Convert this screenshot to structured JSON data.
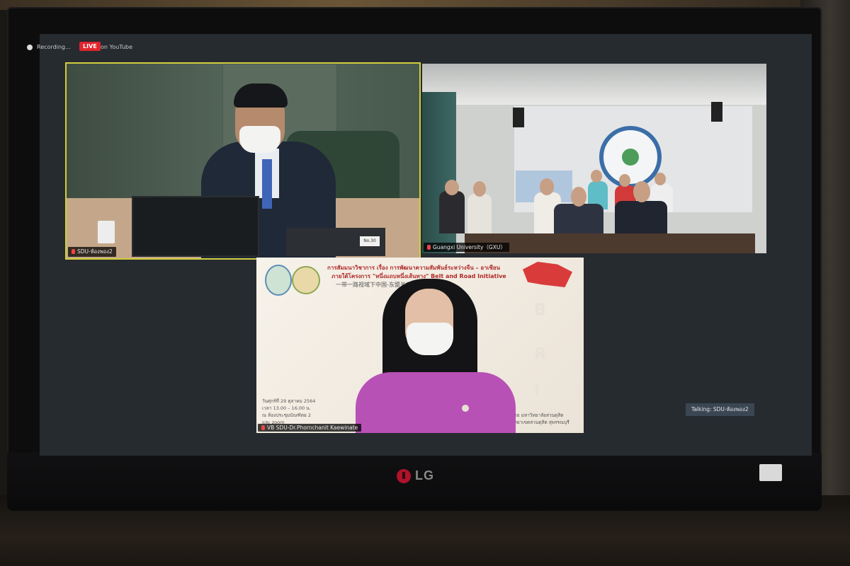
{
  "monitor": {
    "brand": "LG"
  },
  "toolbar": {
    "recording_label": "Recording...",
    "live_label": "LIVE",
    "youtube_label": "on YouTube"
  },
  "tiles": {
    "chair_name": "SDU-ห้องพอง2",
    "chair_nameplate": "No.30",
    "room_name": "Guangxi University（GXU）",
    "speaker_name": "VB SDU-Dr.Phornchanit Kaewinate"
  },
  "slide": {
    "title_line1": "การสัมมนาวิชาการ เรื่อง การพัฒนาความสัมพันธ์ระหว่างจีน – อาเซียน",
    "title_line2": "ภายใต้โครงการ \"หนึ่งแถบหนึ่งเส้นทาง\" Belt and Road Initiative",
    "title_line3": "一带一路视域下中国-东盟关系  29 Oct 2021",
    "letters": [
      "B",
      "R",
      "I"
    ],
    "info_line1": "วันศุกร์ที่ 29 ตุลาคม 2564",
    "info_line2": "เวลา 13.00 – 16.00 น.",
    "info_line3": "ณ ห้องประชุมบัณฑิตย 2",
    "info_line4": "และ zoom",
    "univ_line1": "โดย มหาวิทยาลัยสวนดุสิต",
    "univ_line2": "วิทยาเขตสวนดุสิต สุพรรณบุรี"
  },
  "status": {
    "talking": "Talking: SDU-ห้องพอง2"
  }
}
